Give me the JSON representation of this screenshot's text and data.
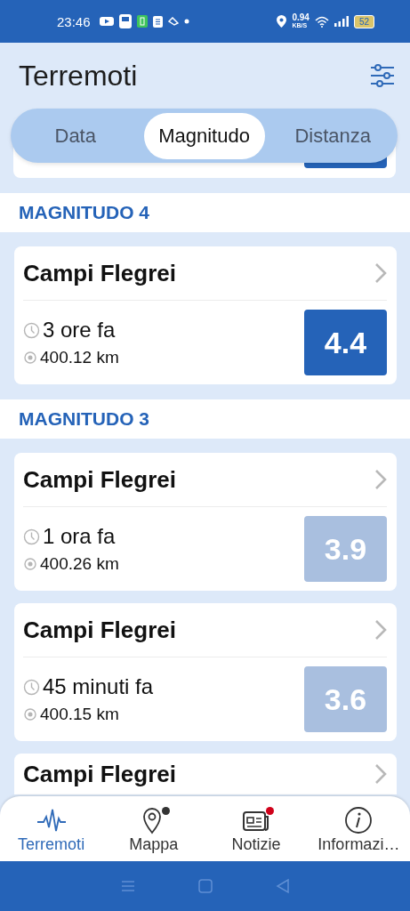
{
  "status_bar": {
    "time": "23:46",
    "speed": "0.94",
    "speed_unit": "KB/S",
    "battery": "52"
  },
  "header": {
    "title": "Terremoti"
  },
  "tabs": [
    {
      "label": "Data",
      "selected": false
    },
    {
      "label": "Magnitudo",
      "selected": true
    },
    {
      "label": "Distanza",
      "selected": false
    }
  ],
  "sections": [
    {
      "title": "MAGNITUDO 4",
      "events": [
        {
          "place": "Campi Flegrei",
          "time": "3 ore fa",
          "distance": "400.12 km",
          "magnitude": "4.4",
          "color": "#2563b8"
        }
      ]
    },
    {
      "title": "MAGNITUDO 3",
      "events": [
        {
          "place": "Campi Flegrei",
          "time": "1 ora fa",
          "distance": "400.26 km",
          "magnitude": "3.9",
          "color": "#a9bfdf"
        },
        {
          "place": "Campi Flegrei",
          "time": "45 minuti fa",
          "distance": "400.15 km",
          "magnitude": "3.6",
          "color": "#a9bfdf"
        },
        {
          "place": "Campi Flegrei"
        }
      ]
    }
  ],
  "bottom_nav": [
    {
      "label": "Terremoti",
      "kind": "wave",
      "selected": true
    },
    {
      "label": "Mappa",
      "kind": "pin",
      "selected": false,
      "color": "#333333"
    },
    {
      "label": "Notizie",
      "kind": "news",
      "selected": false,
      "color": "#d0021b"
    },
    {
      "label": "Informazi…",
      "kind": "info",
      "selected": false
    }
  ]
}
